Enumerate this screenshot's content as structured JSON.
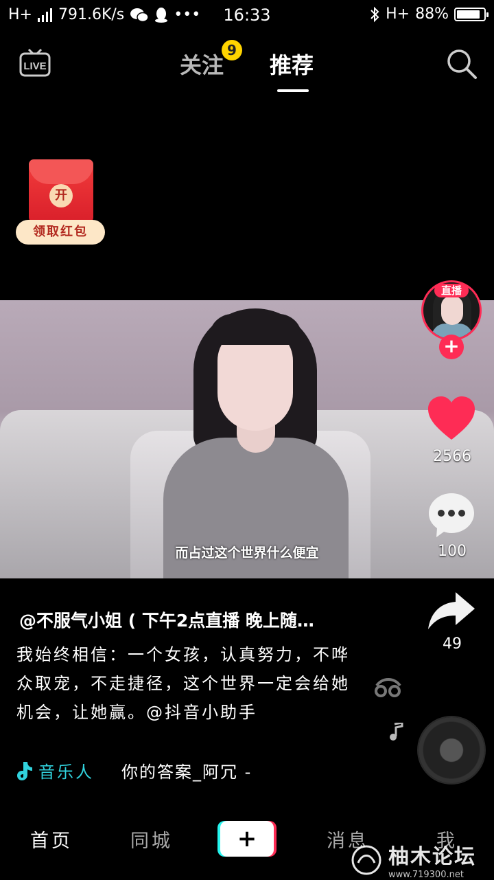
{
  "status_bar": {
    "network": "H+",
    "speed": "791.6K/s",
    "more": "•••",
    "time": "16:33",
    "network_right": "H+",
    "battery_text": "88%",
    "battery_level": 0.88
  },
  "top_nav": {
    "live_label": "LIVE",
    "follow_tab": "关注",
    "follow_badge": "9",
    "recommend_tab": "推荐"
  },
  "red_packet": {
    "coin_text": "开",
    "label": "领取红包"
  },
  "video": {
    "subtitle": "而占过这个世界什么便宜"
  },
  "right_rail": {
    "live_tag": "直播",
    "follow_plus": "+",
    "likes": "2566",
    "comments": "100",
    "shares": "49"
  },
  "caption": {
    "author": "@不服气小姐 ( 下午2点直播 晚上随…",
    "description": "我始终相信：一个女孩，认真努力，不哗众取宠，不走捷径，这个世界一定会给她机会，让她赢。@抖音小助手",
    "music_artist": "音乐人",
    "music_song": "你的答案_阿冗 -"
  },
  "tabbar": {
    "home": "首页",
    "nearby": "同城",
    "create": "+",
    "messages": "消息",
    "me": "我"
  },
  "watermark": {
    "title": "柚木论坛",
    "url": "www.719300.net"
  }
}
